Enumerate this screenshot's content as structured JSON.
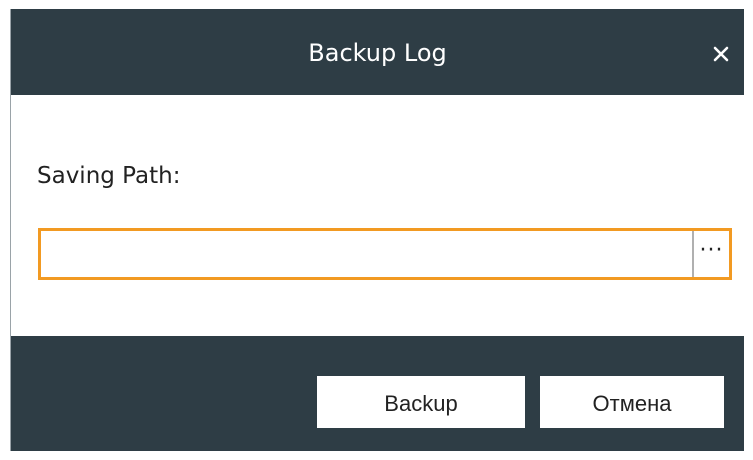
{
  "dialog": {
    "title": "Backup Log",
    "close_icon": "close-icon"
  },
  "form": {
    "saving_path_label": "Saving Path:",
    "saving_path_value": "",
    "browse_label": "···"
  },
  "footer": {
    "backup_label": "Backup",
    "cancel_label": "Отмена"
  },
  "colors": {
    "title_bar": "#2e3d45",
    "footer": "#2e3d45",
    "focus_border": "#f29a22",
    "text": "#222222"
  }
}
